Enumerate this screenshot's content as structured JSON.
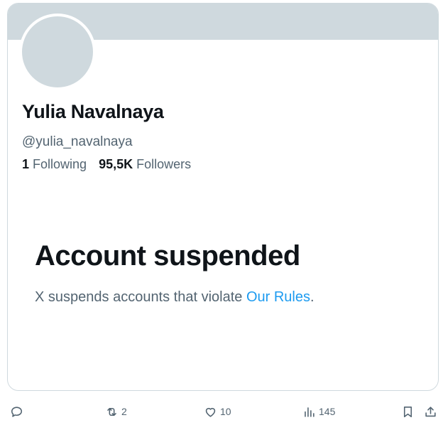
{
  "profile": {
    "display_name": "Yulia Navalnaya",
    "handle": "@yulia_navalnaya",
    "following_count": "1",
    "following_label": "Following",
    "followers_count": "95,5K",
    "followers_label": "Followers"
  },
  "notice": {
    "title": "Account suspended",
    "text_prefix": "X suspends accounts that violate ",
    "link_text": "Our Rules",
    "text_suffix": "."
  },
  "actions": {
    "reply_icon": "reply-icon",
    "retweet_icon": "retweet-icon",
    "retweet_count": "2",
    "like_icon": "heart-icon",
    "like_count": "10",
    "views_icon": "views-icon",
    "views_count": "145",
    "bookmark_icon": "bookmark-icon",
    "share_icon": "share-icon"
  },
  "colors": {
    "banner": "#cfd9de",
    "text_primary": "#0f1419",
    "text_secondary": "#536471",
    "link": "#1d9bf0"
  }
}
